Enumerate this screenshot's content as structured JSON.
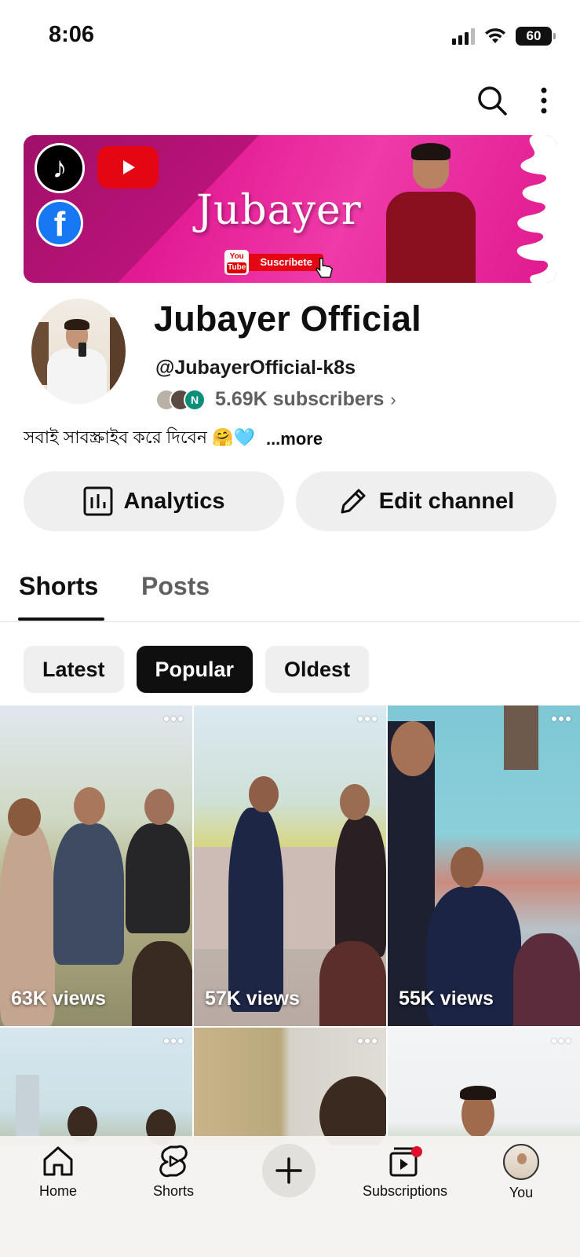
{
  "status_bar": {
    "time": "8:06",
    "battery": "60"
  },
  "banner": {
    "name_text": "Jubayer",
    "sub_button": "Suscríbete",
    "yt_mini_top": "You",
    "yt_mini_bottom": "Tube",
    "tiktok_glyph": "♪",
    "fb_glyph": "f"
  },
  "channel": {
    "title": "Jubayer Official",
    "handle": "@JubayerOfficial-k8s",
    "subscribers": "5.69K subscribers",
    "bio": "সবাই সাবস্ক্রাইব করে দিবেন 🤗🩵",
    "more": "...more",
    "mini_avatar_letter": "N"
  },
  "actions": {
    "analytics_label": "Analytics",
    "edit_label": "Edit channel"
  },
  "tabs": [
    {
      "label": "Shorts"
    },
    {
      "label": "Posts"
    }
  ],
  "chips": [
    {
      "label": "Latest"
    },
    {
      "label": "Popular"
    },
    {
      "label": "Oldest"
    }
  ],
  "shorts": [
    {
      "views": "63K views"
    },
    {
      "views": "57K views"
    },
    {
      "views": "55K views"
    }
  ],
  "nav": {
    "home": "Home",
    "shorts": "Shorts",
    "subscriptions": "Subscriptions",
    "you": "You"
  },
  "colors": {
    "banner_pink": "#e21a94",
    "youtube_red": "#e40613",
    "facebook_blue": "#1877f2",
    "chip_active": "#0f0f0f",
    "chip_idle": "#efefef",
    "subtext_gray": "#606060"
  },
  "icons": [
    "search-icon",
    "more-vert-icon",
    "analytics-icon",
    "pencil-icon",
    "home-icon",
    "shorts-icon",
    "plus-icon",
    "subscriptions-icon"
  ]
}
